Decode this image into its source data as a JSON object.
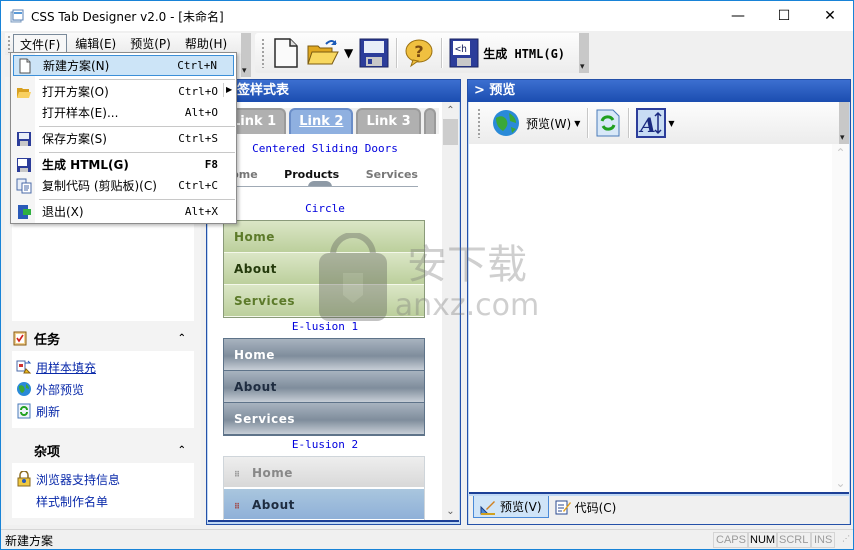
{
  "window": {
    "title": "CSS Tab Designer v2.0 - [未命名]",
    "controls": {
      "minimize": "—",
      "maximize": "☐",
      "close": "✕"
    }
  },
  "menubar": {
    "items": [
      {
        "label": "文件(F)",
        "open": true
      },
      {
        "label": "编辑(E)"
      },
      {
        "label": "预览(P)"
      },
      {
        "label": "帮助(H)"
      }
    ]
  },
  "toolbar": {
    "buttons": [
      {
        "icon": "new-document-icon"
      },
      {
        "icon": "open-folder-icon",
        "dropdown": true
      },
      {
        "icon": "save-disk-icon"
      },
      {
        "icon": "help-icon"
      },
      {
        "icon": "generate-html-icon",
        "label": "生成 HTML(G)"
      }
    ]
  },
  "file_menu": {
    "items": [
      {
        "label": "新建方案(N)",
        "shortcut": "Ctrl+N",
        "icon": "new-document-icon",
        "highlighted": true
      },
      {
        "label": "打开方案(O)",
        "shortcut": "Ctrl+O",
        "icon": "open-folder-icon",
        "submenu": true
      },
      {
        "label": "打开样本(E)...",
        "shortcut": "Alt+O"
      },
      {
        "label": "保存方案(S)",
        "shortcut": "Ctrl+S",
        "icon": "save-disk-icon"
      },
      {
        "label": "生成 HTML(G)",
        "shortcut": "F8",
        "icon": "generate-html-icon",
        "bold": true
      },
      {
        "label": "复制代码 (剪贴板)(C)",
        "shortcut": "Ctrl+C",
        "icon": "copy-icon"
      },
      {
        "label": "退出(X)",
        "shortcut": "Alt+X",
        "icon": "exit-icon"
      }
    ]
  },
  "taskpane": {
    "tasks": {
      "title": "任务",
      "links": [
        {
          "label": "用样本填充",
          "icon": "fill-sample-icon"
        },
        {
          "label": "外部预览",
          "icon": "globe-icon"
        },
        {
          "label": "刷新",
          "icon": "refresh-icon"
        }
      ]
    },
    "misc": {
      "title": "杂项",
      "links": [
        {
          "label": "浏览器支持信息",
          "icon": "browser-lock-icon"
        },
        {
          "label": "样式制作名单",
          "icon": ""
        }
      ]
    }
  },
  "style_panel": {
    "title": "签样式表",
    "tabs_sample": [
      "Link 1",
      "Link 2",
      "Link 3"
    ],
    "active_tab": "Link 2",
    "captions": [
      "Centered Sliding Doors",
      "Circle",
      "E-lusion 1",
      "E-lusion 2"
    ],
    "sliding_doors_items": [
      "Home",
      "Products",
      "Services"
    ],
    "sliding_doors_current": "Products",
    "circle_items": [
      "Home",
      "About",
      "Services"
    ],
    "elusion1_items": [
      "Home",
      "About",
      "Services"
    ],
    "elusion2_items": [
      "Home",
      "About"
    ]
  },
  "preview_panel": {
    "title": "> 预览",
    "toolbar": {
      "preview_label": "预览(W)",
      "refresh_icon": "refresh-icon",
      "font_icon": "font-size-icon"
    },
    "tabs": [
      {
        "label": "预览(V)",
        "active": true,
        "icon": "preview-ruler-icon"
      },
      {
        "label": "代码(C)",
        "active": false,
        "icon": "code-edit-icon"
      }
    ]
  },
  "statusbar": {
    "text": "新建方案",
    "indicators": [
      {
        "label": "CAPS",
        "on": false
      },
      {
        "label": "NUM",
        "on": true
      },
      {
        "label": "SCRL",
        "on": false
      },
      {
        "label": "INS",
        "on": false
      }
    ]
  },
  "colors": {
    "panel_title_blue": "#1b4db0",
    "link_blue": "#0a2aaa",
    "menu_highlight": "#cce4f7",
    "caption_blue": "#0000dd"
  }
}
